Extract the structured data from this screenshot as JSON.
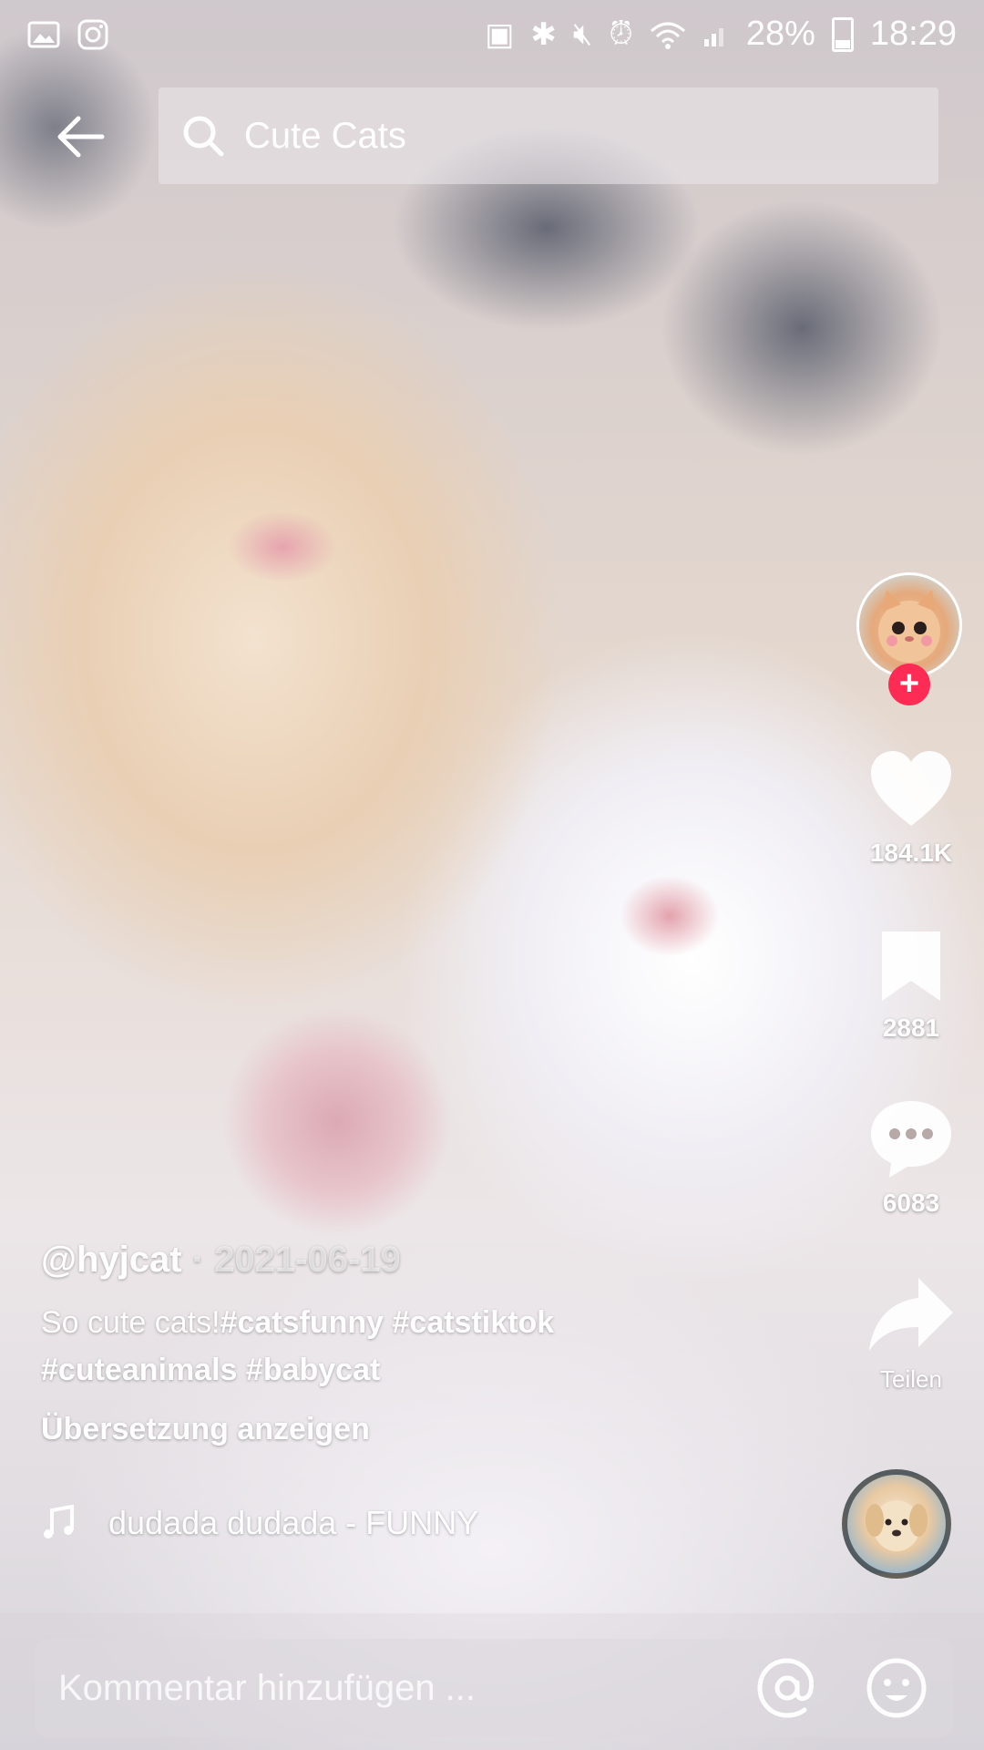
{
  "status_bar": {
    "battery": "28%",
    "time": "18:29"
  },
  "search": {
    "query": "Cute Cats"
  },
  "actions": {
    "likes": "184.1K",
    "bookmarks": "2881",
    "comments": "6083",
    "share_label": "Teilen"
  },
  "post": {
    "author": "@hyjcat",
    "separator": "·",
    "date": "2021-06-19",
    "caption_text": "So cute cats!",
    "hashtags": [
      "#catsfunny",
      "#catstiktok",
      "#cuteanimals",
      "#babycat"
    ],
    "translate_label": "Übersetzung anzeigen",
    "music": "dudada dudada - FUNNY"
  },
  "comment": {
    "placeholder": "Kommentar hinzufügen ..."
  },
  "colors": {
    "follow_accent": "#fe2c55"
  }
}
